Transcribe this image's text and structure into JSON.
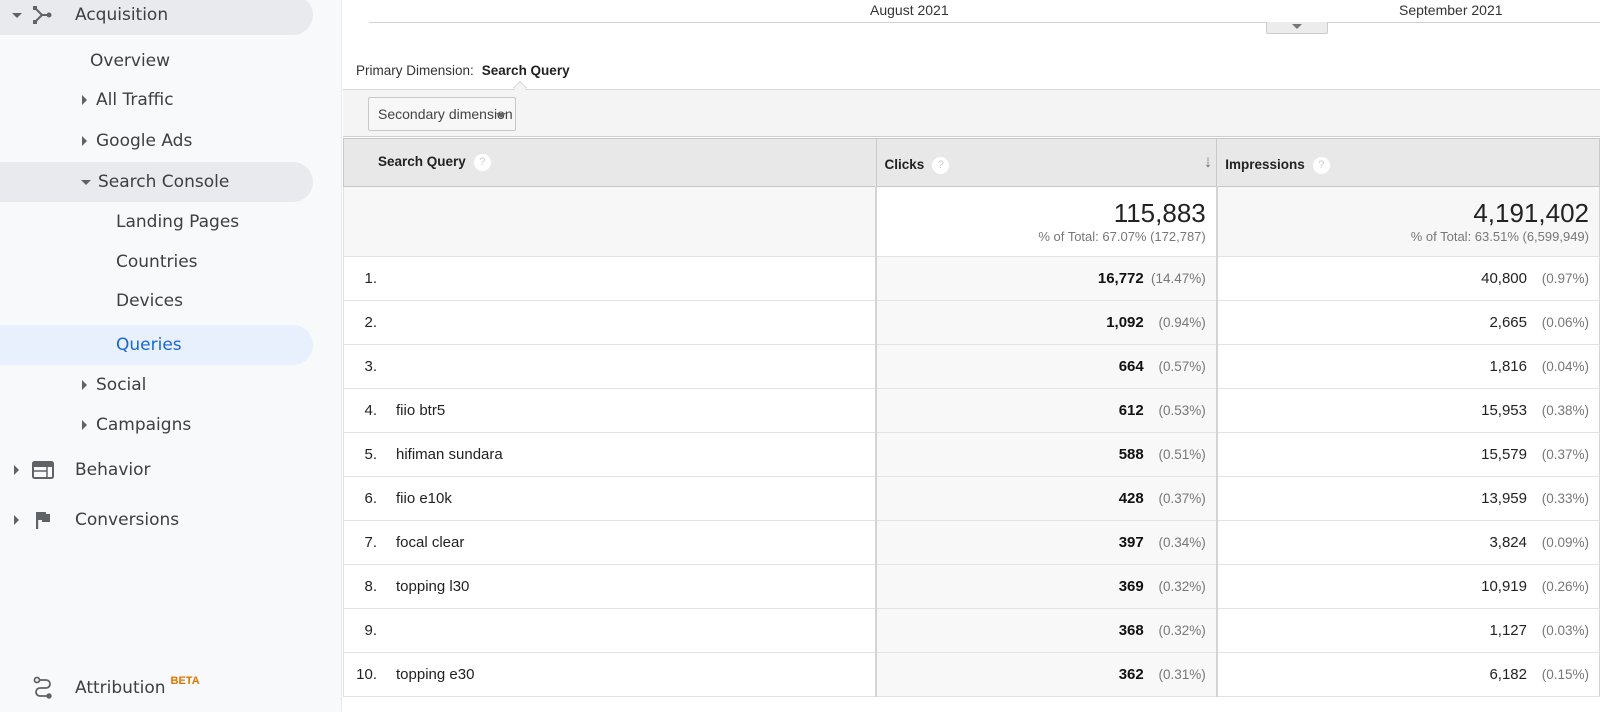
{
  "sidebar": {
    "acquisition": {
      "label": "Acquisition",
      "icon": "acquisition-icon"
    },
    "items": [
      {
        "label": "Overview"
      },
      {
        "label": "All Traffic"
      },
      {
        "label": "Google Ads"
      },
      {
        "label": "Search Console"
      },
      {
        "label": "Landing Pages"
      },
      {
        "label": "Countries"
      },
      {
        "label": "Devices"
      },
      {
        "label": "Queries"
      },
      {
        "label": "Social"
      },
      {
        "label": "Campaigns"
      }
    ],
    "behavior": {
      "label": "Behavior",
      "icon": "behavior-icon"
    },
    "conversions": {
      "label": "Conversions",
      "icon": "flag-icon"
    },
    "attribution": {
      "label": "Attribution",
      "badge": "BETA",
      "icon": "attribution-icon"
    }
  },
  "timeline": {
    "months": [
      "August 2021",
      "September 2021"
    ]
  },
  "dimension": {
    "primary_label": "Primary Dimension:",
    "primary_value": "Search Query",
    "secondary_label": "Secondary dimension"
  },
  "table": {
    "headers": {
      "query": "Search Query",
      "clicks": "Clicks",
      "impressions": "Impressions"
    },
    "help_glyph": "?",
    "sort_glyph": "↓",
    "totals": {
      "clicks": "115,883",
      "clicks_sub": "% of Total: 67.07% (172,787)",
      "impressions": "4,191,402",
      "impressions_sub": "% of Total: 63.51% (6,599,949)"
    },
    "rows": [
      {
        "rank": "1.",
        "query": "",
        "clicks": "16,772",
        "clicks_pct": "(14.47%)",
        "impressions": "40,800",
        "impressions_pct": "(0.97%)"
      },
      {
        "rank": "2.",
        "query": "",
        "clicks": "1,092",
        "clicks_pct": "(0.94%)",
        "impressions": "2,665",
        "impressions_pct": "(0.06%)"
      },
      {
        "rank": "3.",
        "query": "",
        "clicks": "664",
        "clicks_pct": "(0.57%)",
        "impressions": "1,816",
        "impressions_pct": "(0.04%)"
      },
      {
        "rank": "4.",
        "query": "fiio btr5",
        "clicks": "612",
        "clicks_pct": "(0.53%)",
        "impressions": "15,953",
        "impressions_pct": "(0.38%)"
      },
      {
        "rank": "5.",
        "query": "hifiman sundara",
        "clicks": "588",
        "clicks_pct": "(0.51%)",
        "impressions": "15,579",
        "impressions_pct": "(0.37%)"
      },
      {
        "rank": "6.",
        "query": "fiio e10k",
        "clicks": "428",
        "clicks_pct": "(0.37%)",
        "impressions": "13,959",
        "impressions_pct": "(0.33%)"
      },
      {
        "rank": "7.",
        "query": "focal clear",
        "clicks": "397",
        "clicks_pct": "(0.34%)",
        "impressions": "3,824",
        "impressions_pct": "(0.09%)"
      },
      {
        "rank": "8.",
        "query": "topping l30",
        "clicks": "369",
        "clicks_pct": "(0.32%)",
        "impressions": "10,919",
        "impressions_pct": "(0.26%)"
      },
      {
        "rank": "9.",
        "query": "",
        "clicks": "368",
        "clicks_pct": "(0.32%)",
        "impressions": "1,127",
        "impressions_pct": "(0.03%)"
      },
      {
        "rank": "10.",
        "query": "topping e30",
        "clicks": "362",
        "clicks_pct": "(0.31%)",
        "impressions": "6,182",
        "impressions_pct": "(0.15%)"
      }
    ]
  }
}
